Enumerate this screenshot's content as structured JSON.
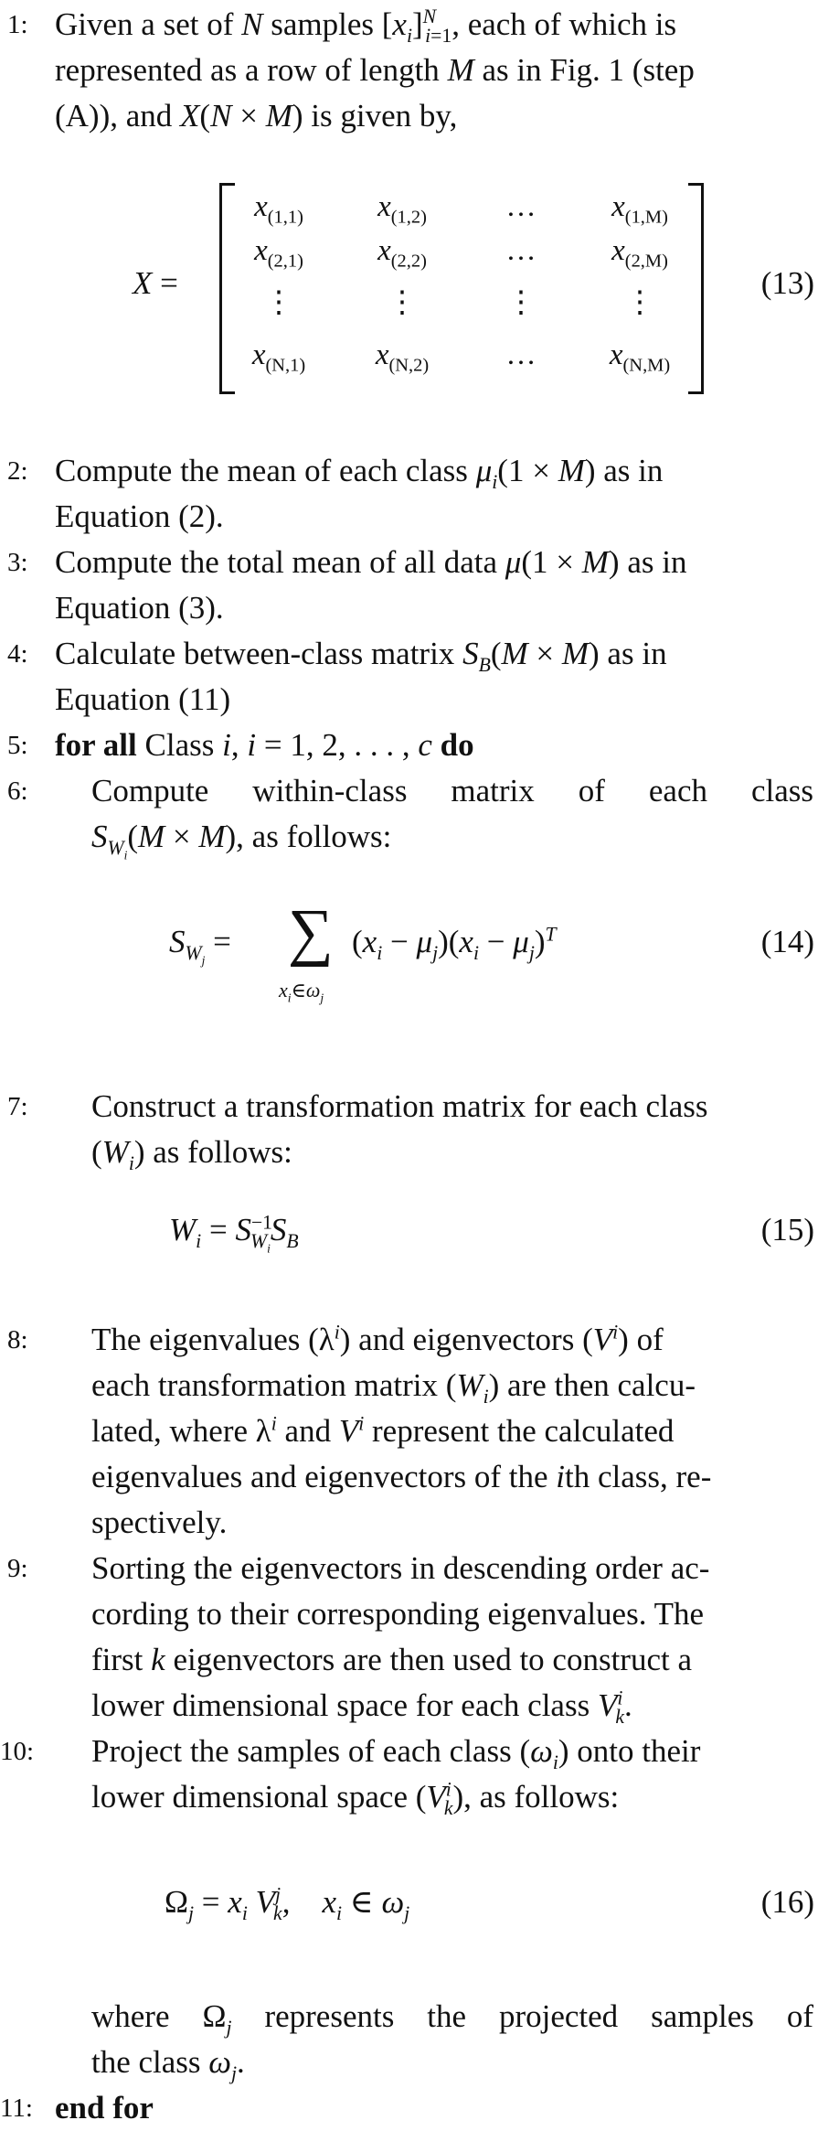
{
  "algorithm": {
    "steps": [
      {
        "num": "1:",
        "lines": [
          "Given a set of N samples [x_i]_{i=1}^N, each of which is",
          "represented as a row of length M as in Fig. 1 (step",
          "(A)), and X(N × M) is given by,"
        ]
      },
      {
        "num": "2:",
        "lines": [
          "Compute the mean of each class μ_i(1 × M) as in",
          "Equation (2)."
        ]
      },
      {
        "num": "3:",
        "lines": [
          "Compute the total mean of all data μ(1 × M) as in",
          "Equation (3)."
        ]
      },
      {
        "num": "4:",
        "lines": [
          "Calculate between-class matrix S_B(M × M) as in",
          "Equation (11)"
        ]
      },
      {
        "num": "5:",
        "lines": [
          "for all Class i, i = 1, 2, ..., c do"
        ]
      },
      {
        "num": "6:",
        "lines": [
          "Compute within-class matrix of each class",
          "S_{W_i}(M × M), as follows:"
        ]
      },
      {
        "num": "7:",
        "lines": [
          "Construct a transformation matrix for each class",
          "(W_i) as follows:"
        ]
      },
      {
        "num": "8:",
        "lines": [
          "The eigenvalues (λ^i) and eigenvectors (V^i) of",
          "each transformation matrix (W_i) are then calcu-",
          "lated, where λ^i and V^i represent the calculated",
          "eigenvalues and eigenvectors of the ith class, re-",
          "spectively."
        ]
      },
      {
        "num": "9:",
        "lines": [
          "Sorting the eigenvectors in descending order ac-",
          "cording to their corresponding eigenvalues. The",
          "first k eigenvectors are then used to construct a",
          "lower dimensional space for each class V_k^i."
        ]
      },
      {
        "num": "10:",
        "lines": [
          "Project the samples of each class (ω_i) onto their",
          "lower dimensional space (V_k^i), as follows:",
          "where Ω_j represents the projected samples of",
          "the class ω_j."
        ]
      },
      {
        "num": "11:",
        "lines": [
          "end for"
        ]
      }
    ],
    "keywords": {
      "for_all": "for all",
      "do": "do",
      "end_for": "end for"
    },
    "equations": [
      {
        "number": "(13)",
        "latex": "X = [x_(1,1) x_(1,2) ... x_(1,M); x_(2,1) x_(2,2) ... x_(2,M); ⋮; x_(N,1) x_(N,2) ... x_(N,M)]"
      },
      {
        "number": "(14)",
        "latex": "S_{W_j} = Σ_{x_i ∈ ω_j} (x_i − μ_j)(x_i − μ_j)^T"
      },
      {
        "number": "(15)",
        "latex": "W_i = S_{W_i}^{−1} S_B"
      },
      {
        "number": "(16)",
        "latex": "Ω_j = x_i V_k^j,  x_i ∈ ω_j"
      }
    ],
    "matrix": {
      "lhs": "X",
      "rows": [
        [
          "(1,1)",
          "(1,2)",
          "…",
          "(1,M)"
        ],
        [
          "(2,1)",
          "(2,2)",
          "…",
          "(2,M)"
        ],
        [
          "⋮",
          "⋮",
          "⋮",
          "⋮"
        ],
        [
          "(N,1)",
          "(N,2)",
          "…",
          "(N,M)"
        ]
      ]
    }
  }
}
